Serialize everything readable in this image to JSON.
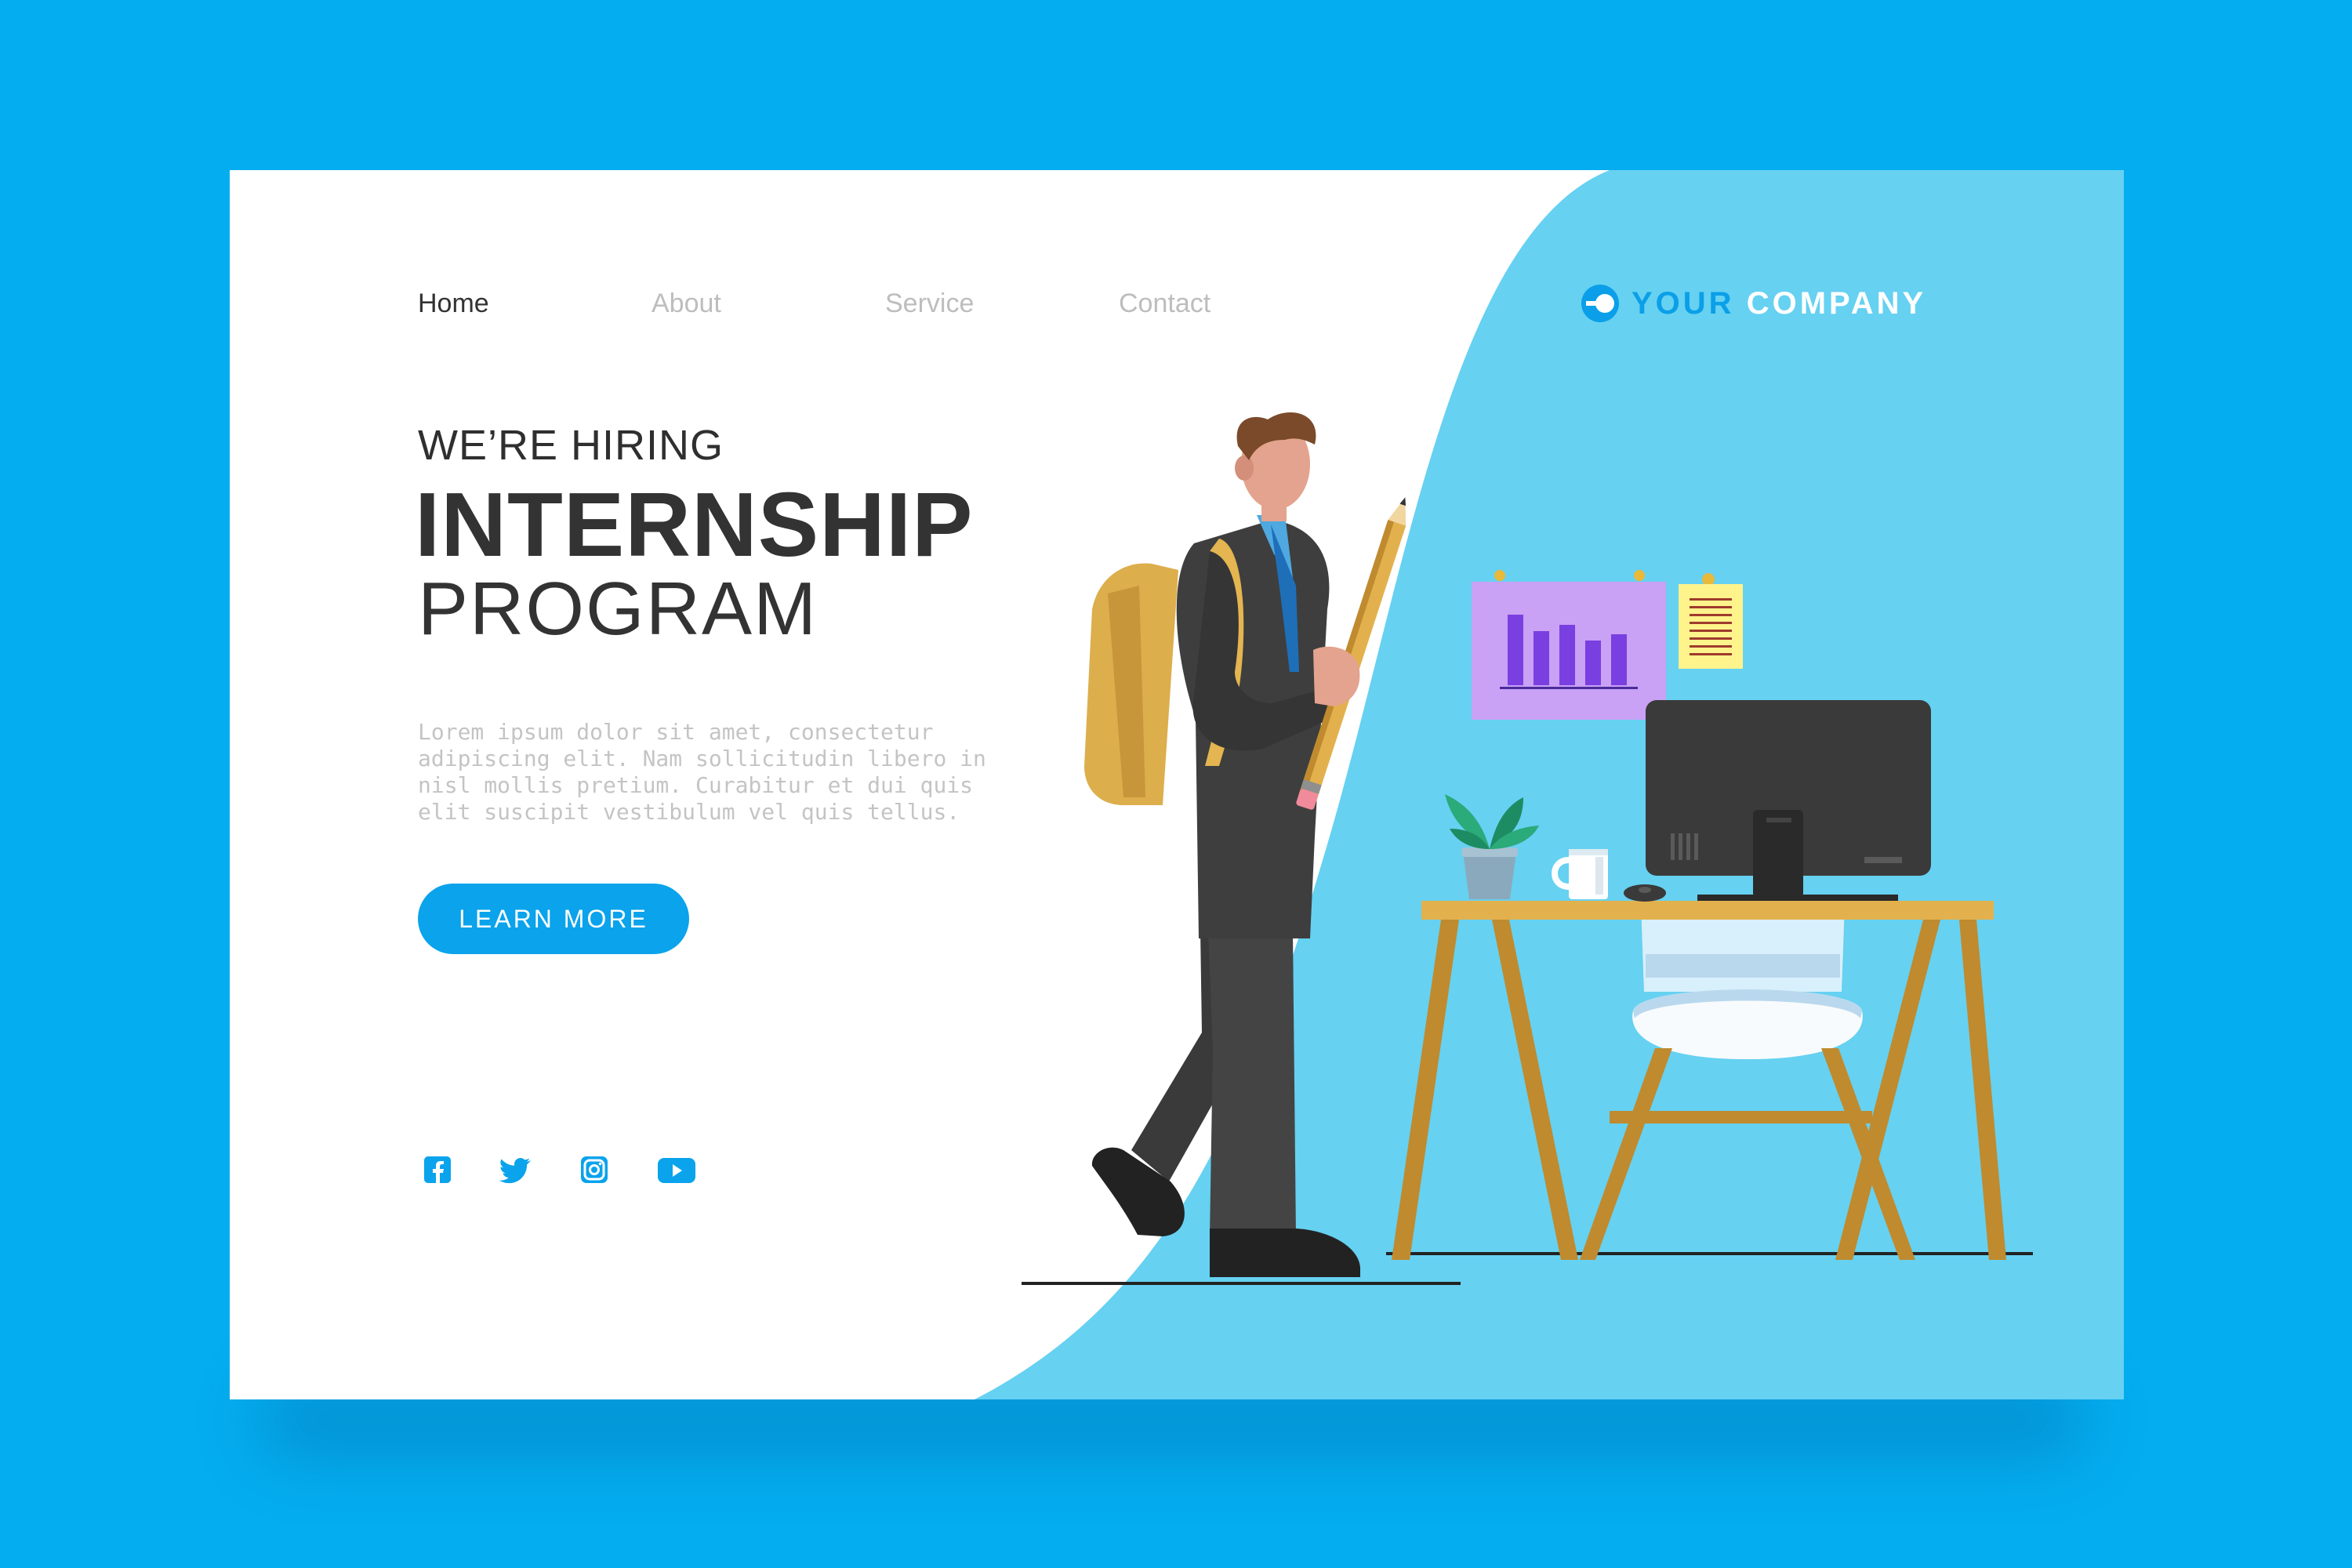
{
  "colors": {
    "outer_background": "#04ADEF",
    "card_background": "#FFFFFF",
    "panel_light_blue": "#66D1F1",
    "accent_blue": "#0AA3EC",
    "text_dark": "#333333",
    "text_muted": "#BDBDBD"
  },
  "nav": {
    "items": [
      {
        "label": "Home",
        "active": true
      },
      {
        "label": "About",
        "active": false
      },
      {
        "label": "Service",
        "active": false
      },
      {
        "label": "Contact",
        "active": false
      }
    ]
  },
  "logo": {
    "icon": "logo-circle-icon",
    "word1": "YOUR",
    "word2": "COMPANY"
  },
  "hero": {
    "kicker": "WE’RE HIRING",
    "title": "INTERNSHIP",
    "subtitle": "PROGRAM",
    "body": "Lorem ipsum dolor sit amet, consectetur adipiscing elit. Nam sollicitudin libero in nisl mollis pretium. Curabitur et dui quis elit suscipit vestibulum vel quis tellus.",
    "cta_label": "LEARN MORE"
  },
  "social": [
    {
      "icon": "facebook-icon"
    },
    {
      "icon": "twitter-icon"
    },
    {
      "icon": "instagram-icon"
    },
    {
      "icon": "youtube-icon"
    }
  ],
  "illustration": {
    "subject": "man-with-backpack-and-pencil-walking-to-desk",
    "objects": [
      "backpack",
      "pencil",
      "wall-chart",
      "sticky-note",
      "plant",
      "mug",
      "monitor",
      "mouse",
      "desk",
      "chair"
    ]
  }
}
